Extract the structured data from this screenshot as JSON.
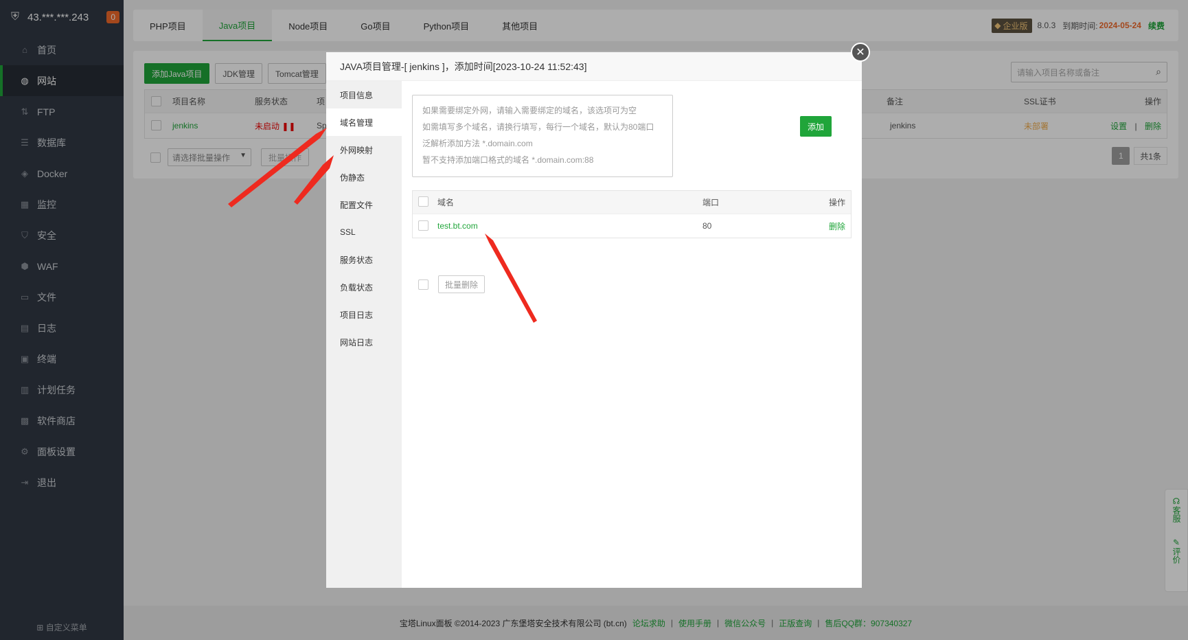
{
  "sidebar": {
    "server": "43.***.***.243",
    "badge": "0",
    "items": [
      {
        "label": "首页",
        "icon": "home-icon",
        "glyph": "⌂"
      },
      {
        "label": "网站",
        "icon": "globe-icon",
        "glyph": "◍"
      },
      {
        "label": "FTP",
        "icon": "ftp-icon",
        "glyph": "⇅"
      },
      {
        "label": "数据库",
        "icon": "database-icon",
        "glyph": "☰"
      },
      {
        "label": "Docker",
        "icon": "docker-icon",
        "glyph": "◈"
      },
      {
        "label": "监控",
        "icon": "monitor-icon",
        "glyph": "▦"
      },
      {
        "label": "安全",
        "icon": "shield-icon",
        "glyph": "⛉"
      },
      {
        "label": "WAF",
        "icon": "waf-icon",
        "glyph": "⬢"
      },
      {
        "label": "文件",
        "icon": "folder-icon",
        "glyph": "▭"
      },
      {
        "label": "日志",
        "icon": "log-icon",
        "glyph": "▤"
      },
      {
        "label": "终端",
        "icon": "terminal-icon",
        "glyph": "▣"
      },
      {
        "label": "计划任务",
        "icon": "calendar-icon",
        "glyph": "▥"
      },
      {
        "label": "软件商店",
        "icon": "apps-icon",
        "glyph": "▩"
      },
      {
        "label": "面板设置",
        "icon": "gear-icon",
        "glyph": "⚙"
      },
      {
        "label": "退出",
        "icon": "logout-icon",
        "glyph": "⇥"
      }
    ],
    "custom_menu": "自定义菜单"
  },
  "tabs": [
    "PHP项目",
    "Java项目",
    "Node项目",
    "Go项目",
    "Python项目",
    "其他项目"
  ],
  "top_right": {
    "edition": "企业版",
    "version": "8.0.3",
    "expire_label": "到期时间:",
    "expire_date": "2024-05-24",
    "renew": "续费"
  },
  "toolbar": {
    "add_java": "添加Java项目",
    "jdk": "JDK管理",
    "tomcat": "Tomcat管理",
    "search_placeholder": "请输入项目名称或备注"
  },
  "table": {
    "headers": {
      "name": "项目名称",
      "status": "服务状态",
      "extra": "项",
      "remark": "备注",
      "ssl": "SSL证书",
      "ops": "操作"
    },
    "row": {
      "name": "jenkins",
      "status": "未启动",
      "extra": "Sp",
      "remark": "jenkins",
      "ssl": "未部署",
      "set": "设置",
      "sep": "|",
      "del": "删除"
    },
    "batch_placeholder": "请选择批量操作",
    "batch_btn": "批量操作",
    "page": "1",
    "total": "共1条"
  },
  "modal": {
    "title": "JAVA项目管理-[ jenkins ]，添加时间[2023-10-24 11:52:43]",
    "nav": [
      "项目信息",
      "域名管理",
      "外网映射",
      "伪静态",
      "配置文件",
      "SSL",
      "服务状态",
      "负载状态",
      "项目日志",
      "网站日志"
    ],
    "textarea_hint": [
      "如果需要绑定外网，请输入需要绑定的域名，该选项可为空",
      "如需填写多个域名，请换行填写，每行一个域名，默认为80端口",
      "泛解析添加方法 *.domain.com",
      "暂不支持添加端口格式的域名 *.domain.com:88"
    ],
    "add_btn": "添加",
    "domain_table": {
      "headers": {
        "domain": "域名",
        "port": "端口",
        "ops": "操作"
      },
      "rows": [
        {
          "domain": "test.bt.com",
          "port": "80",
          "op": "删除"
        }
      ]
    },
    "bulk_delete": "批量删除"
  },
  "float": {
    "service": "客服",
    "review": "评价"
  },
  "footer": {
    "copyright": "宝塔Linux面板 ©2014-2023 广东堡塔安全技术有限公司 (bt.cn)",
    "links": [
      "论坛求助",
      "使用手册",
      "微信公众号",
      "正版查询"
    ],
    "qq": "售后QQ群：907340327"
  }
}
